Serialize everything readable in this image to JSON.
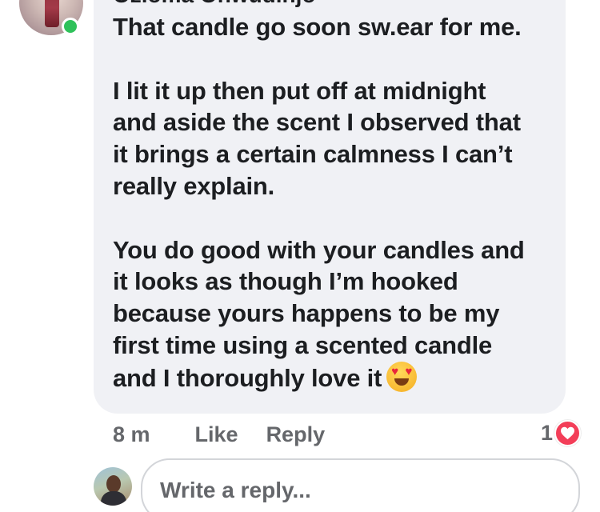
{
  "comment": {
    "author": "Ozioma Onwudinjo",
    "paragraphs": [
      "That candle go soon sw.ear for me.",
      "I lit it up then put off at midnight\nand aside the scent I observed that\nit brings a certain calmness I can’t\nreally explain.",
      "You do good with your candles and\nit looks as though I’m hooked\nbecause yours happens to be my\nfirst time using a scented candle\nand I thoroughly love it"
    ],
    "emoji": "heart-eyes-emoji",
    "timestamp": "8 m",
    "like_label": "Like",
    "reply_label": "Reply",
    "reaction_count": "1",
    "reaction_icon": "heart-icon"
  },
  "reply_composer": {
    "placeholder": "Write a reply..."
  },
  "colors": {
    "bubble": "#f0f1f5",
    "text": "#1c1e21",
    "secondary_text": "#65676b",
    "online": "#2fc15a",
    "heart": "#f33e58"
  }
}
